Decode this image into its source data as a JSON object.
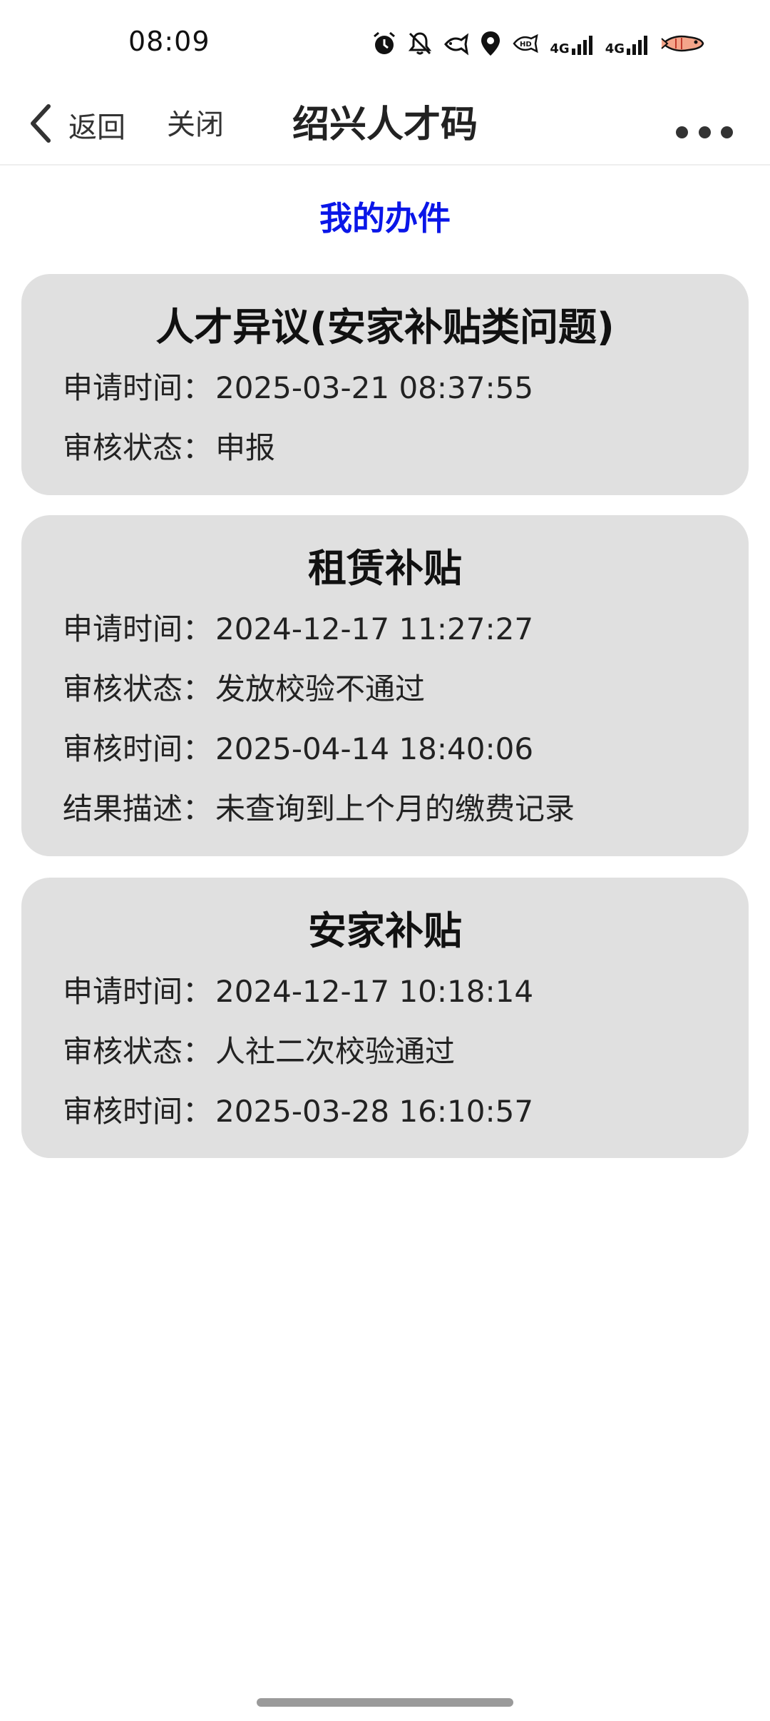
{
  "status_bar": {
    "time": "08:09",
    "network_1": "4G",
    "network_2": "4G",
    "icons": [
      "alarm-icon",
      "mute-icon",
      "fish-icon",
      "location-icon",
      "hd-icon",
      "signal-icon",
      "signal-icon",
      "battery-fish-icon"
    ]
  },
  "nav": {
    "back_label": "返回",
    "close_label": "关闭",
    "title": "绍兴人才码"
  },
  "page": {
    "heading": "我的办件",
    "heading_color": "#0a16e8"
  },
  "cards": [
    {
      "title": "人才异议(安家补贴类问题)",
      "rows": [
        {
          "label": "申请时间：",
          "value": "2025-03-21 08:37:55"
        },
        {
          "label": "审核状态：",
          "value": "申报"
        }
      ]
    },
    {
      "title": "租赁补贴",
      "rows": [
        {
          "label": "申请时间：",
          "value": "2024-12-17 11:27:27"
        },
        {
          "label": "审核状态：",
          "value": "发放校验不通过"
        },
        {
          "label": "审核时间：",
          "value": "2025-04-14 18:40:06"
        },
        {
          "label": "结果描述：",
          "value": "未查询到上个月的缴费记录"
        }
      ]
    },
    {
      "title": "安家补贴",
      "rows": [
        {
          "label": "申请时间：",
          "value": "2024-12-17 10:18:14"
        },
        {
          "label": "审核状态：",
          "value": "人社二次校验通过"
        },
        {
          "label": "审核时间：",
          "value": "2025-03-28 16:10:57"
        }
      ]
    }
  ]
}
